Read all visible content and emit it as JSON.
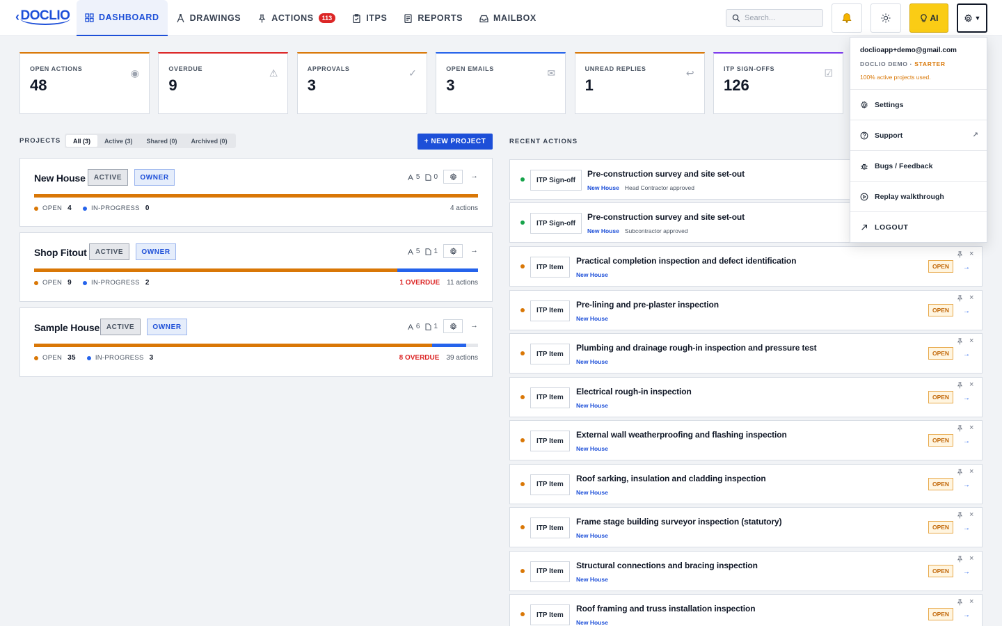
{
  "app": {
    "logo": "DOCLIO"
  },
  "nav": [
    {
      "label": "DASHBOARD",
      "icon": "grid-icon",
      "active": true
    },
    {
      "label": "DRAWINGS",
      "icon": "compass-icon"
    },
    {
      "label": "ACTIONS",
      "icon": "pin-icon",
      "badge": "113"
    },
    {
      "label": "ITPS",
      "icon": "clipboard-icon"
    },
    {
      "label": "REPORTS",
      "icon": "report-icon"
    },
    {
      "label": "MAILBOX",
      "icon": "inbox-icon"
    }
  ],
  "search": {
    "placeholder": "Search..."
  },
  "toolbar": {
    "ai_label": "AI"
  },
  "stats": [
    {
      "label": "OPEN ACTIONS",
      "value": "48",
      "icon": "◉",
      "color": "#d97706"
    },
    {
      "label": "OVERDUE",
      "value": "9",
      "icon": "⚠",
      "color": "#dc2626"
    },
    {
      "label": "APPROVALS",
      "value": "3",
      "icon": "✓",
      "color": "#d97706"
    },
    {
      "label": "OPEN EMAILS",
      "value": "3",
      "icon": "✉",
      "color": "#2563eb"
    },
    {
      "label": "UNREAD REPLIES",
      "value": "1",
      "icon": "↩",
      "color": "#d97706"
    },
    {
      "label": "ITP SIGN-OFFS",
      "value": "126",
      "icon": "☑",
      "color": "#7c3aed"
    }
  ],
  "projects": {
    "title": "PROJECTS",
    "tabs": [
      "All (3)",
      "Active (3)",
      "Shared (0)",
      "Archived (0)"
    ],
    "new_label": "+ NEW PROJECT",
    "open_label": "OPEN",
    "inprog_label": "IN-PROGRESS",
    "items": [
      {
        "name": "New House",
        "status": "ACTIVE",
        "role": "OWNER",
        "members": "5",
        "docs": "0",
        "open": "4",
        "inprog": "0",
        "overdue": "",
        "actions": "4 actions",
        "open_frac": 1.0,
        "inprog_frac": 0.0
      },
      {
        "name": "Shop Fitout",
        "status": "ACTIVE",
        "role": "OWNER",
        "members": "5",
        "docs": "1",
        "open": "9",
        "inprog": "2",
        "overdue": "1 OVERDUE",
        "actions": "11 actions",
        "open_frac": 0.818,
        "inprog_frac": 0.182
      },
      {
        "name": "Sample House",
        "status": "ACTIVE",
        "role": "OWNER",
        "members": "6",
        "docs": "1",
        "open": "35",
        "inprog": "3",
        "overdue": "8 OVERDUE",
        "actions": "39 actions",
        "open_frac": 0.897,
        "inprog_frac": 0.077
      }
    ]
  },
  "recent": {
    "title": "RECENT ACTIONS",
    "items": [
      {
        "kind": "ITP Sign-off",
        "title": "Pre-construction survey and site set-out",
        "project": "New House",
        "note": "Head Contractor approved",
        "dot": "#16a34a",
        "status": ""
      },
      {
        "kind": "ITP Sign-off",
        "title": "Pre-construction survey and site set-out",
        "project": "New House",
        "note": "Subcontractor approved",
        "dot": "#16a34a",
        "status": ""
      },
      {
        "kind": "ITP Item",
        "title": "Practical completion inspection and defect identification",
        "project": "New House",
        "note": "",
        "dot": "#d97706",
        "status": "OPEN"
      },
      {
        "kind": "ITP Item",
        "title": "Pre-lining and pre-plaster inspection",
        "project": "New House",
        "note": "",
        "dot": "#d97706",
        "status": "OPEN"
      },
      {
        "kind": "ITP Item",
        "title": "Plumbing and drainage rough-in inspection and pressure test",
        "project": "New House",
        "note": "",
        "dot": "#d97706",
        "status": "OPEN"
      },
      {
        "kind": "ITP Item",
        "title": "Electrical rough-in inspection",
        "project": "New House",
        "note": "",
        "dot": "#d97706",
        "status": "OPEN"
      },
      {
        "kind": "ITP Item",
        "title": "External wall weatherproofing and flashing inspection",
        "project": "New House",
        "note": "",
        "dot": "#d97706",
        "status": "OPEN"
      },
      {
        "kind": "ITP Item",
        "title": "Roof sarking, insulation and cladding inspection",
        "project": "New House",
        "note": "",
        "dot": "#d97706",
        "status": "OPEN"
      },
      {
        "kind": "ITP Item",
        "title": "Frame stage building surveyor inspection (statutory)",
        "project": "New House",
        "note": "",
        "dot": "#d97706",
        "status": "OPEN"
      },
      {
        "kind": "ITP Item",
        "title": "Structural connections and bracing inspection",
        "project": "New House",
        "note": "",
        "dot": "#d97706",
        "status": "OPEN"
      },
      {
        "kind": "ITP Item",
        "title": "Roof framing and truss installation inspection",
        "project": "New House",
        "note": "",
        "dot": "#d97706",
        "status": "OPEN"
      }
    ]
  },
  "menu": {
    "email": "doclioapp+demo@gmail.com",
    "plan_prefix": "DOCLIO DEMO · ",
    "plan": "STARTER",
    "usage": "100% active projects used.",
    "items": [
      {
        "label": "Settings",
        "icon": "gear-icon"
      },
      {
        "label": "Support",
        "icon": "help-icon",
        "external": true
      },
      {
        "label": "Bugs / Feedback",
        "icon": "bug-icon"
      },
      {
        "label": "Replay walkthrough",
        "icon": "replay-icon"
      },
      {
        "label": "LOGOUT",
        "icon": "logout-icon"
      }
    ]
  }
}
